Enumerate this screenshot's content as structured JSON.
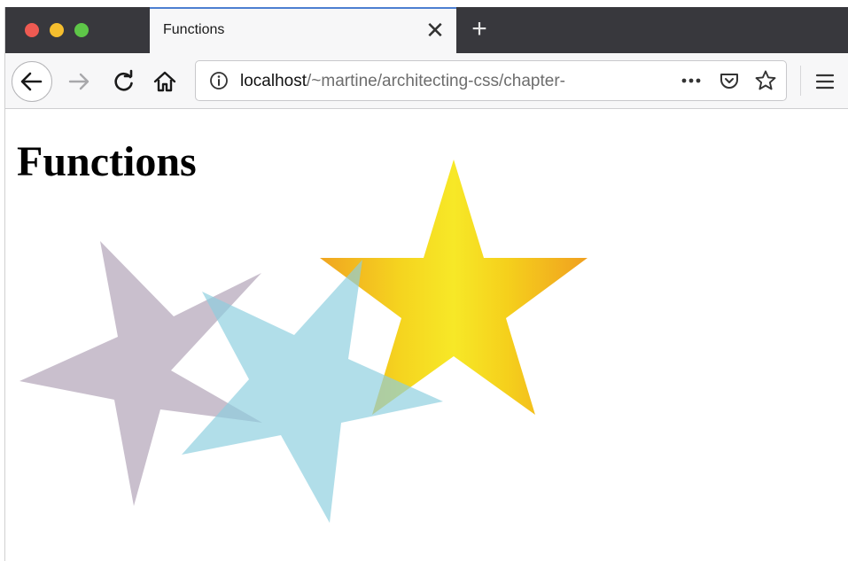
{
  "browser": {
    "tab": {
      "title": "Functions",
      "close_glyph": "✕"
    },
    "new_tab_glyph": "+",
    "nav": {
      "back_icon": "back-arrow-icon",
      "forward_icon": "forward-arrow-icon",
      "reload_icon": "reload-icon",
      "home_icon": "home-icon",
      "menu_icon": "hamburger-menu-icon"
    },
    "url": {
      "host": "localhost",
      "path": "/~martine/architecting-css/chapter-"
    },
    "url_actions": {
      "more_icon": "more-dots-icon",
      "pocket_icon": "pocket-icon",
      "bookmark_icon": "star-bookmark-icon",
      "info_icon": "info-icon"
    }
  },
  "page": {
    "title": "Functions",
    "stars": [
      {
        "name": "mauve-star",
        "fill": "#c9bfcd"
      },
      {
        "name": "blue-star",
        "fill": "#9fd3e0",
        "opacity": 0.75
      },
      {
        "name": "gold-star",
        "gradient": [
          "#f0a521",
          "#f5d41f",
          "#f7e827",
          "#f5d01c",
          "#f0a020"
        ]
      }
    ]
  }
}
